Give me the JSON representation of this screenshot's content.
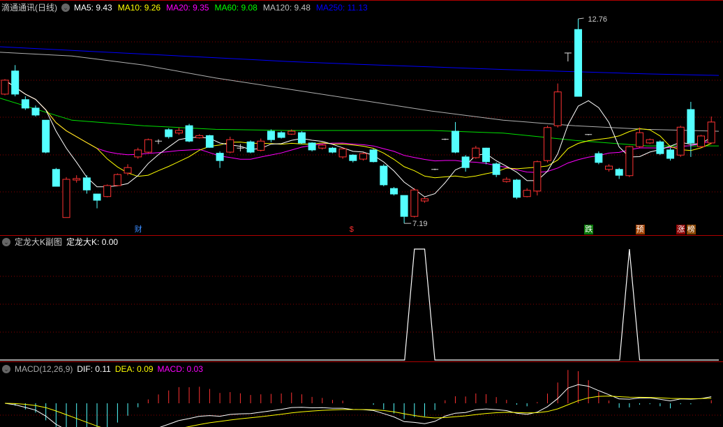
{
  "main_panel": {
    "stock_name": "滴通通讯(日线)",
    "ma_labels": [
      {
        "text": "MA5: 9.43",
        "color": "#ffffff"
      },
      {
        "text": "MA10: 9.26",
        "color": "#ffff00"
      },
      {
        "text": "MA20: 9.35",
        "color": "#ff00ff"
      },
      {
        "text": "MA60: 9.08",
        "color": "#00ff00"
      },
      {
        "text": "MA120: 9.48",
        "color": "#c0c0c0"
      },
      {
        "text": "MA250: 11.13",
        "color": "#0000ff"
      }
    ],
    "high_label": "12.76",
    "low_label": "7.19",
    "markers": [
      {
        "text": "财",
        "color": "#3b8cff",
        "bg": "transparent",
        "candle": 13
      },
      {
        "text": "$",
        "color": "#ff3030",
        "bg": "transparent",
        "candle": 34
      },
      {
        "text": "跌",
        "color": "#ffffff",
        "bg": "#0a7a0a",
        "candle": 57
      },
      {
        "text": "预",
        "color": "#ffffff",
        "bg": "#a04000",
        "candle": 62
      },
      {
        "text": "涨",
        "color": "#ffffff",
        "bg": "#8b0000",
        "candle": 66
      },
      {
        "text": "榜",
        "color": "#ffffff",
        "bg": "#8b4500",
        "candle": 67
      }
    ]
  },
  "sub_panel": {
    "title": "定龙大K副图",
    "value_label": "定龙大K: 0.00"
  },
  "macd_panel": {
    "title": "MACD(12,26,9)",
    "dif_label": "DIF: 0.11",
    "dea_label": "DEA: 0.09",
    "macd_label": "MACD: 0.03"
  },
  "colors": {
    "up": "#ff3232",
    "down": "#54ffff",
    "grid": "#8b0000",
    "separator": "#b00000"
  },
  "chart_data": {
    "type": "candlestick",
    "ylim": [
      7.19,
      12.76
    ],
    "candles_ohlc": [
      [
        10.71,
        11.09,
        11.12,
        10.68
      ],
      [
        11.34,
        10.71,
        11.5,
        10.65
      ],
      [
        10.56,
        10.33,
        10.65,
        10.28
      ],
      [
        10.33,
        10.14,
        10.4,
        10.1
      ],
      [
        10.0,
        9.13,
        10.0,
        9.1
      ],
      [
        8.66,
        8.2,
        8.7,
        8.2
      ],
      [
        7.35,
        8.39,
        8.45,
        7.35
      ],
      [
        8.37,
        8.41,
        8.5,
        8.3
      ],
      [
        8.43,
        8.1,
        8.5,
        8.0
      ],
      [
        7.99,
        7.82,
        8.0,
        7.6
      ],
      [
        7.92,
        8.22,
        8.25,
        7.9
      ],
      [
        8.22,
        8.52,
        8.55,
        8.2
      ],
      [
        8.56,
        8.71,
        8.8,
        8.5
      ],
      [
        9.0,
        9.19,
        9.25,
        8.95
      ],
      [
        9.13,
        9.47,
        9.5,
        9.1
      ],
      [
        9.41,
        9.43,
        9.48,
        9.35
      ],
      [
        9.74,
        9.55,
        9.78,
        9.5
      ],
      [
        9.65,
        9.72,
        9.8,
        9.6
      ],
      [
        9.85,
        9.43,
        9.9,
        9.4
      ],
      [
        9.52,
        9.58,
        9.62,
        9.5
      ],
      [
        9.58,
        9.26,
        9.6,
        9.25
      ],
      [
        9.1,
        8.9,
        9.15,
        8.7
      ],
      [
        9.13,
        9.47,
        9.55,
        9.1
      ],
      [
        9.22,
        9.24,
        9.35,
        9.15
      ],
      [
        9.41,
        9.13,
        9.45,
        9.1
      ],
      [
        9.18,
        9.43,
        9.5,
        9.15
      ],
      [
        9.7,
        9.47,
        9.75,
        9.4
      ],
      [
        9.66,
        9.53,
        9.7,
        9.5
      ],
      [
        9.62,
        9.7,
        9.75,
        9.6
      ],
      [
        9.66,
        9.38,
        9.7,
        9.35
      ],
      [
        9.38,
        9.19,
        9.4,
        9.15
      ],
      [
        9.24,
        9.32,
        9.35,
        9.2
      ],
      [
        9.24,
        9.13,
        9.27,
        9.1
      ],
      [
        9.0,
        9.22,
        9.25,
        8.95
      ],
      [
        9.05,
        8.9,
        9.07,
        8.85
      ],
      [
        8.94,
        9.09,
        9.12,
        8.9
      ],
      [
        9.19,
        8.87,
        9.22,
        8.85
      ],
      [
        8.75,
        8.24,
        8.8,
        8.2
      ],
      [
        8.14,
        7.99,
        8.18,
        7.95
      ],
      [
        7.95,
        7.38,
        7.95,
        7.19
      ],
      [
        7.38,
        8.1,
        8.15,
        7.35
      ],
      [
        7.8,
        7.86,
        7.9,
        7.75
      ],
      [
        8.65,
        8.66,
        8.68,
        8.64
      ],
      [
        9.47,
        9.48,
        9.5,
        9.46
      ],
      [
        9.7,
        9.13,
        9.95,
        9.1
      ],
      [
        9.0,
        8.71,
        9.05,
        8.6
      ],
      [
        8.98,
        9.24,
        9.3,
        8.95
      ],
      [
        9.24,
        8.87,
        9.25,
        8.8
      ],
      [
        8.81,
        8.52,
        8.85,
        8.45
      ],
      [
        8.33,
        8.39,
        8.45,
        8.3
      ],
      [
        8.37,
        7.9,
        8.4,
        7.85
      ],
      [
        7.92,
        8.09,
        8.15,
        7.9
      ],
      [
        8.07,
        8.87,
        8.9,
        7.95
      ],
      [
        8.9,
        9.8,
        9.85,
        8.85
      ],
      [
        9.85,
        10.77,
        11.0,
        9.8
      ],
      [
        11.82,
        11.83,
        11.84,
        11.6
      ],
      [
        12.47,
        10.65,
        12.76,
        10.65
      ],
      [
        9.6,
        9.61,
        9.62,
        9.59
      ],
      [
        9.09,
        8.85,
        9.15,
        8.8
      ],
      [
        8.66,
        8.75,
        8.8,
        8.6
      ],
      [
        8.66,
        8.5,
        8.7,
        8.4
      ],
      [
        8.49,
        9.28,
        9.3,
        8.45
      ],
      [
        9.28,
        9.66,
        9.8,
        9.25
      ],
      [
        9.38,
        9.47,
        9.5,
        9.35
      ],
      [
        9.41,
        9.09,
        9.45,
        9.05
      ],
      [
        9.19,
        8.96,
        9.25,
        8.9
      ],
      [
        9.05,
        9.81,
        9.85,
        9.0
      ],
      [
        10.29,
        9.38,
        10.5,
        9.0
      ],
      [
        9.28,
        9.57,
        9.6,
        9.25
      ],
      [
        9.38,
        9.95,
        10.1,
        9.35
      ]
    ],
    "ma60": [
      10.6,
      10.0,
      9.85,
      9.75,
      9.72,
      9.72,
      9.72,
      9.65,
      9.45,
      9.3,
      9.3
    ],
    "ma120": [
      11.85,
      11.75,
      11.5,
      11.15,
      10.85,
      10.55,
      10.25,
      10.0,
      9.85,
      9.75,
      9.7
    ],
    "ma250": [
      12.0,
      11.9,
      11.8,
      11.7,
      11.6,
      11.52,
      11.45,
      11.38,
      11.32,
      11.26,
      11.22
    ],
    "dragon_k": [
      0,
      0,
      0,
      0,
      0,
      0,
      0,
      0,
      0,
      0,
      0,
      0,
      0,
      0,
      0,
      0,
      0,
      0,
      0,
      0,
      0,
      0,
      0,
      0,
      0,
      0,
      0,
      0,
      0,
      0,
      0,
      0,
      0,
      0,
      0,
      0,
      0,
      0,
      0,
      0,
      1,
      1,
      0,
      0,
      0,
      0,
      0,
      0,
      0,
      0,
      0,
      0,
      0,
      0,
      0,
      0,
      0,
      0,
      0,
      0,
      0,
      1,
      0,
      0,
      0,
      0,
      0,
      0,
      0,
      0
    ]
  }
}
